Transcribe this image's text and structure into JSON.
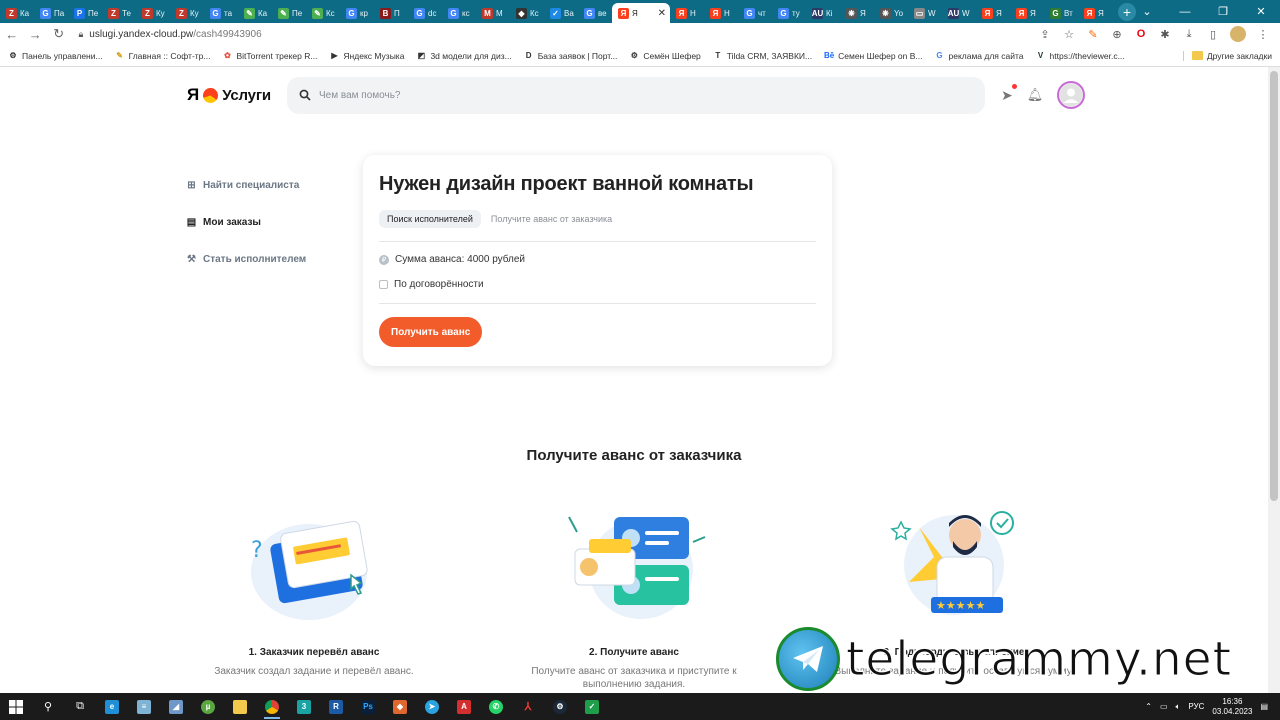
{
  "browser": {
    "tabs": [
      {
        "label": "Ка",
        "color": "#c0392b",
        "glyph": "Z"
      },
      {
        "label": "Па",
        "color": "#4285f4",
        "glyph": "G"
      },
      {
        "label": "Пе",
        "color": "#1a73e8",
        "glyph": "P"
      },
      {
        "label": "Те",
        "color": "#c0392b",
        "glyph": "Z"
      },
      {
        "label": "Ку",
        "color": "#c0392b",
        "glyph": "Z"
      },
      {
        "label": "Ку",
        "color": "#c0392b",
        "glyph": "Z"
      },
      {
        "label": "та",
        "color": "#4285f4",
        "glyph": "G"
      },
      {
        "label": "Ка",
        "color": "#4caf50",
        "glyph": "✎"
      },
      {
        "label": "Пе",
        "color": "#4caf50",
        "glyph": "✎"
      },
      {
        "label": "Кс",
        "color": "#4caf50",
        "glyph": "✎"
      },
      {
        "label": "кр",
        "color": "#4285f4",
        "glyph": "G"
      },
      {
        "label": "П",
        "color": "#8b1a1a",
        "glyph": "B"
      },
      {
        "label": "dc",
        "color": "#4285f4",
        "glyph": "G"
      },
      {
        "label": "кс",
        "color": "#4285f4",
        "glyph": "G"
      },
      {
        "label": "М",
        "color": "#c0392b",
        "glyph": "M"
      },
      {
        "label": "Кс",
        "color": "#333333",
        "glyph": "◆"
      },
      {
        "label": "Ва",
        "color": "#1e88e5",
        "glyph": "✓"
      },
      {
        "label": "ве",
        "color": "#4285f4",
        "glyph": "G"
      },
      {
        "label": "Я",
        "color": "#fc3f1d",
        "glyph": "Я"
      },
      {
        "label": "Н",
        "color": "#fc3f1d",
        "glyph": "Я"
      },
      {
        "label": "Н",
        "color": "#fc3f1d",
        "glyph": "Я"
      },
      {
        "label": "чт",
        "color": "#4285f4",
        "glyph": "G"
      },
      {
        "label": "ту",
        "color": "#4285f4",
        "glyph": "G"
      },
      {
        "label": "Кі",
        "color": "#2b3a67",
        "glyph": "AU"
      },
      {
        "label": "Я",
        "color": "#555555",
        "glyph": "❋"
      },
      {
        "label": "Yo",
        "color": "#555555",
        "glyph": "❋"
      },
      {
        "label": "W",
        "color": "#888888",
        "glyph": "▭"
      },
      {
        "label": "W",
        "color": "#2b3a67",
        "glyph": "AU"
      },
      {
        "label": "Я",
        "color": "#fc3f1d",
        "glyph": "Я"
      },
      {
        "label": "Я",
        "color": "#fc3f1d",
        "glyph": "Я"
      },
      {
        "label": "Вт",
        "color": "#2e7d32",
        "glyph": "G"
      },
      {
        "label": "Я",
        "color": "#fc3f1d",
        "glyph": "Я"
      }
    ],
    "active_tab_index": 18,
    "url_host": "uslugi.yandex-cloud.pw",
    "url_path": "/cash49943906",
    "bookmarks": [
      {
        "label": "Панель управлени...",
        "icon": "⚙",
        "color": "#333333"
      },
      {
        "label": "Главная :: Софт-тр...",
        "icon": "✎",
        "color": "#d4a017"
      },
      {
        "label": "BitTorrent трекер R...",
        "icon": "✿",
        "color": "#e84c3d"
      },
      {
        "label": "Яндекс Музыка",
        "icon": "▶",
        "color": "#333333"
      },
      {
        "label": "3d модели для диз...",
        "icon": "◩",
        "color": "#333333"
      },
      {
        "label": "База заявок | Порт...",
        "icon": "D",
        "color": "#333333"
      },
      {
        "label": "Семён Шефер",
        "icon": "⚙",
        "color": "#333333"
      },
      {
        "label": "Tilda CRM, ЗАЯВКИ...",
        "icon": "T",
        "color": "#333333"
      },
      {
        "label": "Семен Шефер on B...",
        "icon": "Bē",
        "color": "#1769ff"
      },
      {
        "label": "реклама для сайта",
        "icon": "G",
        "color": "#4285f4"
      },
      {
        "label": "https://theviewer.c...",
        "icon": "V",
        "color": "#1d3b2a"
      }
    ],
    "other_bookmarks": "Другие закладки"
  },
  "site": {
    "logo_ya": "Я",
    "logo_text": "Услуги",
    "search_placeholder": "Чем вам помочь?",
    "nav": [
      {
        "label": "Найти специалиста",
        "icon": "grid-icon",
        "active": false
      },
      {
        "label": "Мои заказы",
        "icon": "orders-icon",
        "active": true
      },
      {
        "label": "Стать исполнителем",
        "icon": "wrench-icon",
        "active": false
      }
    ],
    "order": {
      "title": "Нужен дизайн проект ванной комнаты",
      "status_active": "Поиск исполнителей",
      "status_next": "Получите аванс от заказчика",
      "advance": "Сумма аванса: 4000 рублей",
      "terms": "По договорённости",
      "button": "Получить аванс"
    },
    "how_title": "Получите аванс от заказчика",
    "how_steps": [
      {
        "title": "1. Заказчик перевёл аванс",
        "desc": "Заказчик создал задание и перевёл аванс."
      },
      {
        "title": "2. Получите аванс",
        "desc": "Получите аванс от заказчика и приступите к выполнению задания."
      },
      {
        "title": "3. Подтвердите выполнение",
        "desc": "Выполните задание и получите оставшуюся сумму."
      }
    ]
  },
  "watermark": "telegrammy.net",
  "taskbar": {
    "lang": "РУС",
    "time": "16:36",
    "date": "03.04.2023"
  },
  "colors": {
    "accent": "#f25c2a",
    "tabbar": "#0e6b86",
    "yandex_red": "#fc3f1d"
  }
}
